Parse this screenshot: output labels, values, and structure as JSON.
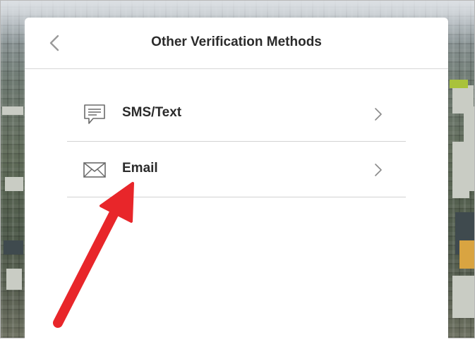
{
  "dialog": {
    "title": "Other Verification Methods"
  },
  "options": [
    {
      "label": "SMS/Text",
      "icon": "message-icon"
    },
    {
      "label": "Email",
      "icon": "envelope-icon"
    }
  ],
  "annotation": {
    "arrow_color": "#e8262a",
    "points_to": "Email"
  },
  "colors": {
    "panel_bg": "#ffffff",
    "text": "#2b2b2b",
    "divider": "#d2d2d2",
    "icon_gray": "#6b6b6b"
  }
}
